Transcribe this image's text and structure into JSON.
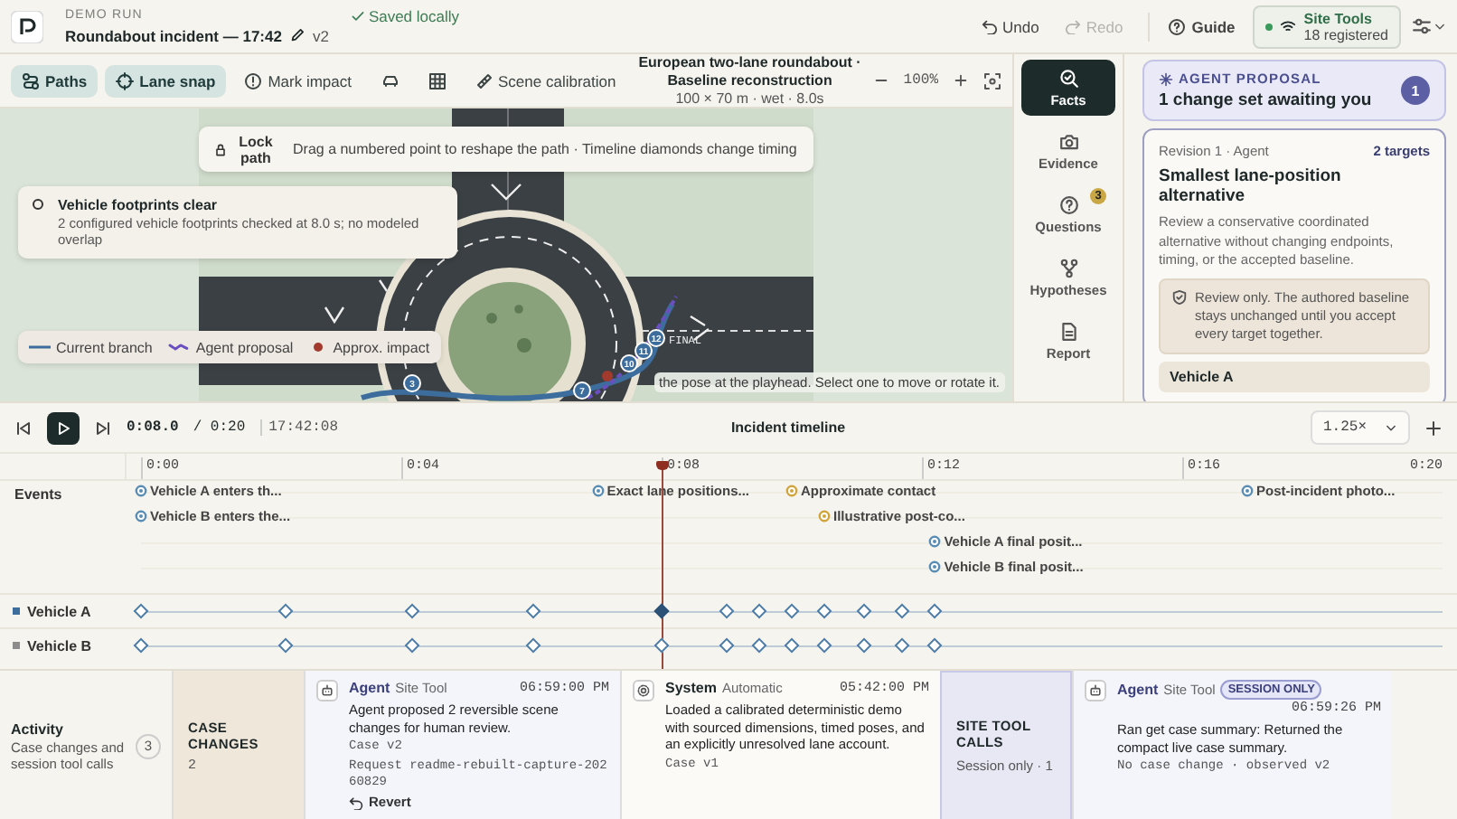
{
  "header": {
    "eyebrow": "DEMO RUN",
    "title": "Roundabout incident — 17:42",
    "version": "v2",
    "save_status": "Saved locally",
    "undo": {
      "label": "Undo",
      "disabled": false
    },
    "redo": {
      "label": "Redo",
      "disabled": true
    },
    "guide": "Guide",
    "site_tools": {
      "title": "Site Tools",
      "subtitle": "18 registered",
      "connected": true
    }
  },
  "toolbar": {
    "tools": [
      {
        "kind": "paths",
        "label": "Paths",
        "selected": true
      },
      {
        "kind": "snap",
        "label": "Lane snap",
        "selected": true
      },
      {
        "kind": "impact",
        "label": "Mark impact",
        "selected": false
      },
      {
        "kind": "vehicle",
        "selected": false
      },
      {
        "kind": "grid",
        "selected": false
      },
      {
        "kind": "calibration",
        "label": "Scene calibration",
        "selected": false
      }
    ],
    "scene_title": "European two-lane roundabout · Baseline reconstruction",
    "scene_subtitle": "100 × 70 m · wet · 8.0s",
    "zoom": "100%"
  },
  "canvas": {
    "hint": {
      "button": "Lock path",
      "text": "Drag a numbered point to reshape the path · Timeline diamonds change timing"
    },
    "check": {
      "title": "Vehicle footprints clear",
      "text": "2 configured vehicle footprints checked at 8.0 s; no modeled overlap"
    },
    "legend": [
      {
        "kind": "line",
        "label": "Current branch"
      },
      {
        "kind": "proposal",
        "label": "Agent proposal"
      },
      {
        "kind": "dot",
        "label": "Approx. impact"
      }
    ],
    "path_points": [
      "3",
      "7",
      "10",
      "11",
      "12"
    ],
    "map_label": "FINAL",
    "caption": "the pose at the playhead. Select one to move or rotate it."
  },
  "rail": [
    {
      "kind": "facts",
      "label": "Facts",
      "selected": true
    },
    {
      "kind": "evidence",
      "label": "Evidence",
      "selected": false
    },
    {
      "kind": "questions",
      "label": "Questions",
      "selected": false,
      "badge": "3"
    },
    {
      "kind": "hypotheses",
      "label": "Hypotheses",
      "selected": false
    },
    {
      "kind": "report",
      "label": "Report",
      "selected": false
    }
  ],
  "proposal": {
    "eyebrow": "AGENT PROPOSAL",
    "title": "1 change set awaiting you",
    "count": "1",
    "revision": {
      "meta": "Revision 1 · Agent",
      "targets": "2 targets",
      "title": "Smallest lane-position alternative",
      "description": "Review a conservative coordinated alternative without changing endpoints, timing, or the accepted baseline.",
      "note": "Review only. The authored baseline stays unchanged until you accept every target together.",
      "target": "Vehicle A"
    }
  },
  "timeline": {
    "title": "Incident timeline",
    "playing": false,
    "position": "0:08.0",
    "duration": "/ 0:20",
    "clock": "17:42:08",
    "speed": "1.25×",
    "ticks": [
      "0:00",
      "0:04",
      "0:08",
      "0:12",
      "0:16",
      "0:20"
    ],
    "playhead": {
      "level": 0.4
    },
    "events_label": "Events",
    "event_rows": [
      [
        {
          "label": "Vehicle A enters th...",
          "level": 0,
          "color": "#5a8db3"
        },
        {
          "label": "Exact lane positions...",
          "level": 0.351,
          "color": "#5a8db3"
        },
        {
          "label": "Approximate contact",
          "level": 0.5,
          "color": "#d2a53c"
        },
        {
          "label": "Post-incident photo...",
          "level": 0.85,
          "color": "#5a8db3"
        }
      ],
      [
        {
          "label": "Vehicle B enters the...",
          "level": 0,
          "color": "#5a8db3"
        },
        {
          "label": "Illustrative post-co...",
          "level": 0.525,
          "color": "#d2a53c"
        }
      ],
      [
        {
          "label": "Vehicle A final posit...",
          "level": 0.61,
          "color": "#5a8db3"
        }
      ],
      [
        {
          "label": "Vehicle B final posit...",
          "level": 0.61,
          "color": "#5a8db3"
        }
      ]
    ],
    "tracks": [
      {
        "label": "Vehicle A",
        "color": "#3d6d9c",
        "keyframes": [
          {
            "level": 0,
            "selected": false
          },
          {
            "level": 0.111,
            "selected": false
          },
          {
            "level": 0.2085,
            "selected": false
          },
          {
            "level": 0.3015,
            "selected": false
          },
          {
            "level": 0.4,
            "selected": true
          },
          {
            "level": 0.45,
            "selected": false
          },
          {
            "level": 0.475,
            "selected": false
          },
          {
            "level": 0.5,
            "selected": false
          },
          {
            "level": 0.525,
            "selected": false
          },
          {
            "level": 0.555,
            "selected": false
          },
          {
            "level": 0.585,
            "selected": false
          },
          {
            "level": 0.61,
            "selected": false
          }
        ]
      },
      {
        "label": "Vehicle B",
        "color": "#8c8c8c",
        "keyframes": [
          {
            "level": 0,
            "selected": false
          },
          {
            "level": 0.111,
            "selected": false
          },
          {
            "level": 0.2085,
            "selected": false
          },
          {
            "level": 0.3015,
            "selected": false
          },
          {
            "level": 0.4,
            "selected": false
          },
          {
            "level": 0.45,
            "selected": false
          },
          {
            "level": 0.475,
            "selected": false
          },
          {
            "level": 0.5,
            "selected": false
          },
          {
            "level": 0.525,
            "selected": false
          },
          {
            "level": 0.555,
            "selected": false
          },
          {
            "level": 0.585,
            "selected": false
          },
          {
            "level": 0.61,
            "selected": false
          }
        ]
      }
    ]
  },
  "activity": {
    "title": "Activity",
    "subtitle": "Case changes and session tool calls",
    "count": "3",
    "groups": [
      {
        "kind": "case",
        "title": "CASE CHANGES",
        "subtitle": "2",
        "entries": [
          {
            "kind": "agent",
            "actor": "Agent",
            "source": "Site Tool",
            "time": "06:59:00 PM",
            "text": "Agent proposed 2 reversible scene changes for human review.",
            "details": [
              "Case v2",
              "Request readme-rebuilt-capture-20260829"
            ],
            "action": "Revert"
          },
          {
            "kind": "system",
            "actor": "System",
            "source": "Automatic",
            "time": "05:42:00 PM",
            "text": "Loaded a calibrated deterministic demo with sourced dimensions, timed poses, and an explicitly unresolved lane account.",
            "details": [
              "Case v1"
            ]
          }
        ]
      },
      {
        "kind": "session",
        "title": "SITE TOOL CALLS",
        "subtitle": "Session only · 1",
        "entries": [
          {
            "kind": "agent",
            "actor": "Agent",
            "source": "Site Tool",
            "badge": "SESSION ONLY",
            "time": "06:59:26 PM",
            "text": "Ran get case summary: Returned the compact live case summary.",
            "details": [
              "No case change · observed v2"
            ]
          }
        ]
      }
    ]
  }
}
